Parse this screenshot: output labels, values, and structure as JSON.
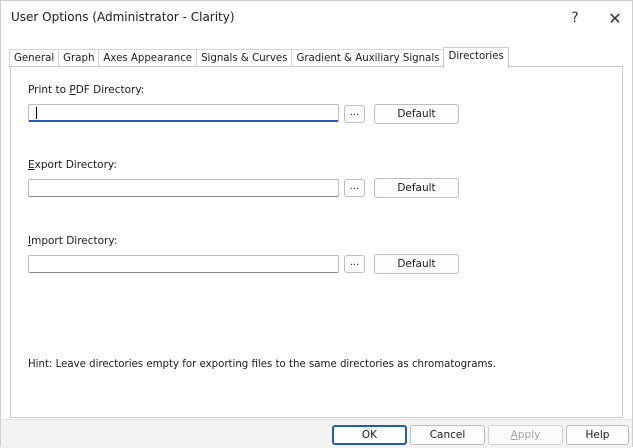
{
  "window": {
    "title": "User Options (Administrator - Clarity)",
    "help_glyph": "?",
    "close_glyph": "✕"
  },
  "tabs": [
    {
      "label": "General"
    },
    {
      "label": "Graph"
    },
    {
      "label": "Axes Appearance"
    },
    {
      "label": "Signals & Curves"
    },
    {
      "label": "Gradient & Auxiliary Signals"
    },
    {
      "label": "Directories",
      "active": true
    }
  ],
  "directories": {
    "print_pdf": {
      "label_pre": "Print to ",
      "label_accel": "P",
      "label_post": "DF Directory:",
      "value": "",
      "browse": "...",
      "default": "Default"
    },
    "export": {
      "label_accel": "E",
      "label_post": "xport Directory:",
      "value": "",
      "browse": "...",
      "default": "Default"
    },
    "import": {
      "label_accel": "I",
      "label_post": "mport Directory:",
      "value": "",
      "browse": "...",
      "default": "Default"
    }
  },
  "hint": "Hint: Leave directories empty for exporting files to the same directories as chromatograms.",
  "footer": {
    "ok": "OK",
    "cancel": "Cancel",
    "apply_accel": "A",
    "apply_post": "pply",
    "help": "Help"
  }
}
